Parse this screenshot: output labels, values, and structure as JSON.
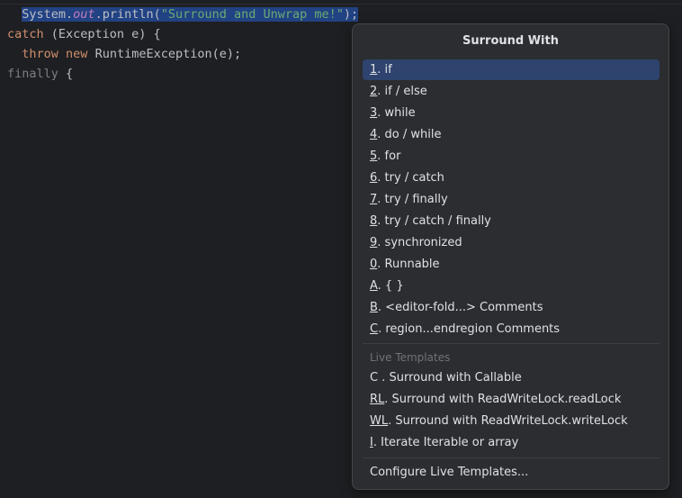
{
  "editor": {
    "line1": {
      "indent": "  ",
      "obj": "System.",
      "field": "out",
      "method": ".println(",
      "string": "\"Surround and Unwrap me!\"",
      "tail": ");"
    },
    "line2": {
      "kw": "catch",
      "rest": " (Exception e) {"
    },
    "line3": {
      "indent": "  ",
      "kw1": "throw",
      "sp": " ",
      "kw2": "new",
      "rest": " RuntimeException(e);"
    },
    "line4": {
      "kw": "finally",
      "rest": " {"
    }
  },
  "popup": {
    "title": "Surround With",
    "items": [
      {
        "key": "1",
        "label": ". if",
        "selected": true
      },
      {
        "key": "2",
        "label": ". if / else"
      },
      {
        "key": "3",
        "label": ". while"
      },
      {
        "key": "4",
        "label": ". do / while"
      },
      {
        "key": "5",
        "label": ". for"
      },
      {
        "key": "6",
        "label": ". try / catch"
      },
      {
        "key": "7",
        "label": ". try / finally"
      },
      {
        "key": "8",
        "label": ". try / catch / finally"
      },
      {
        "key": "9",
        "label": ". synchronized"
      },
      {
        "key": "0",
        "label": ". Runnable"
      },
      {
        "key": "A",
        "label": ". { }"
      },
      {
        "key": "B",
        "label": ". <editor-fold...> Comments"
      },
      {
        "key": "C",
        "label": ". region...endregion Comments"
      }
    ],
    "live_templates_label": "Live Templates",
    "live_templates": [
      {
        "key": "",
        "label": "C . Surround with Callable"
      },
      {
        "key": "RL",
        "label": ". Surround with ReadWriteLock.readLock"
      },
      {
        "key": "WL",
        "label": ". Surround with ReadWriteLock.writeLock"
      },
      {
        "key": "I",
        "label": ". Iterate Iterable or array"
      }
    ],
    "configure_label": "Configure Live Templates..."
  },
  "colors": {
    "background": "#1e1f22",
    "popup_background": "#2b2d30",
    "selection": "#2e436e",
    "editor_selection": "#214283",
    "keyword": "#cf8e6d",
    "string": "#6aab73",
    "field": "#c77dbb"
  }
}
